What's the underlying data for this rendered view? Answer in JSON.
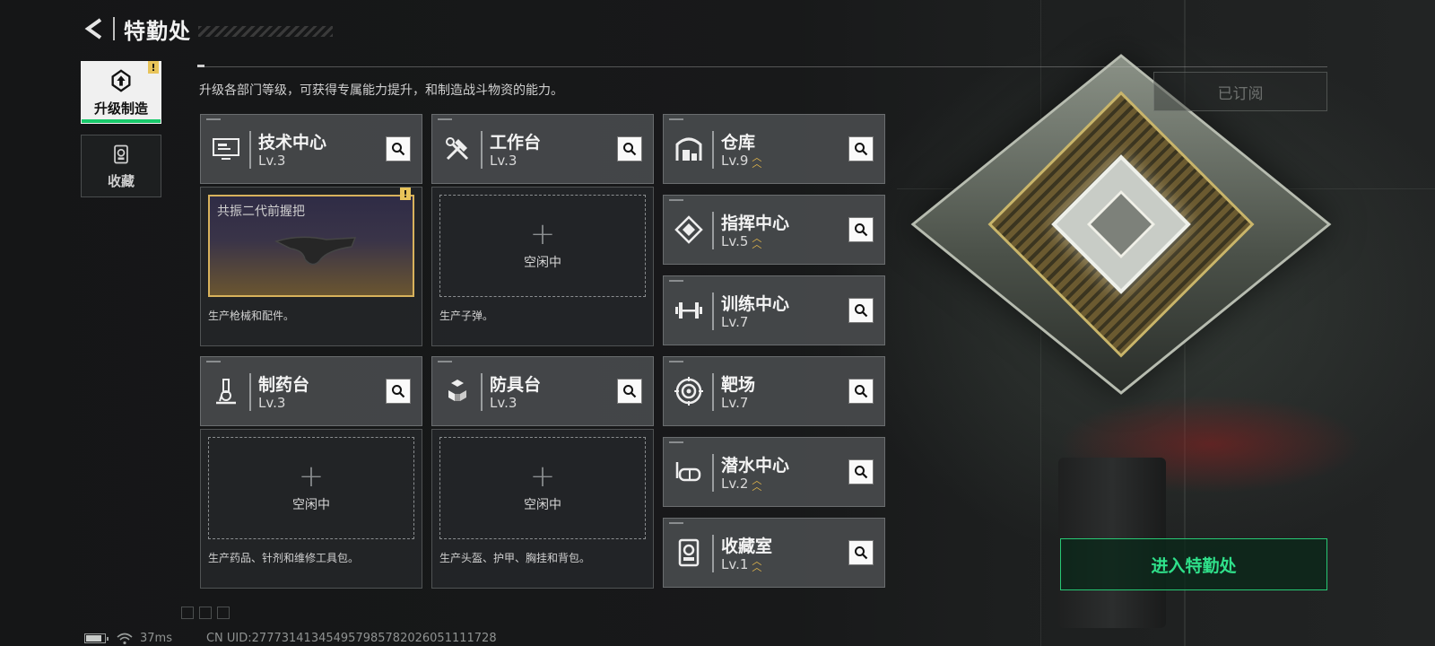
{
  "header": {
    "title": "特勤处"
  },
  "tabs": [
    {
      "label": "升级制造",
      "active": true,
      "alert": "!"
    },
    {
      "label": "收藏",
      "active": false
    }
  ],
  "description": "升级各部门等级，可获得专属能力提升，和制造战斗物资的能力。",
  "subscribed_label": "已订阅",
  "stations": {
    "tech_center": {
      "name": "技术中心",
      "level": "Lv.3",
      "icon": "monitor-icon"
    },
    "workbench": {
      "name": "工作台",
      "level": "Lv.3",
      "icon": "tools-icon"
    },
    "pharmacy": {
      "name": "制药台",
      "level": "Lv.3",
      "icon": "microscope-icon"
    },
    "armor_bench": {
      "name": "防具台",
      "level": "Lv.3",
      "icon": "cubes-icon"
    },
    "warehouse": {
      "name": "仓库",
      "level": "Lv.9",
      "icon": "warehouse-icon",
      "upgradable": true
    },
    "command_center": {
      "name": "指挥中心",
      "level": "Lv.5",
      "icon": "command-icon",
      "upgradable": true
    },
    "training_center": {
      "name": "训练中心",
      "level": "Lv.7",
      "icon": "dumbbell-icon"
    },
    "shooting_range": {
      "name": "靶场",
      "level": "Lv.7",
      "icon": "target-icon"
    },
    "diving_center": {
      "name": "潜水中心",
      "level": "Lv.2",
      "icon": "diving-mask-icon",
      "upgradable": true
    },
    "collection_room": {
      "name": "收藏室",
      "level": "Lv.1",
      "icon": "collection-icon",
      "upgradable": true
    }
  },
  "production": {
    "tech_center": {
      "item": "共振二代前握把",
      "alert": "!",
      "desc": "生产枪械和配件。"
    },
    "workbench": {
      "slot": "空闲中",
      "desc": "生产子弹。"
    },
    "pharmacy": {
      "slot": "空闲中",
      "desc": "生产药品、针剂和维修工具包。"
    },
    "armor_bench": {
      "slot": "空闲中",
      "desc": "生产头盔、护甲、胸挂和背包。"
    }
  },
  "enter_button": "进入特勤处",
  "status_bar": {
    "battery_level": 0.85,
    "ping": "37ms",
    "uid": "CN UID:277731413454957985782026051111728"
  },
  "colors": {
    "accent": "#2fe08a",
    "alert": "#e8c45a",
    "upgrade": "#e6b94a"
  }
}
